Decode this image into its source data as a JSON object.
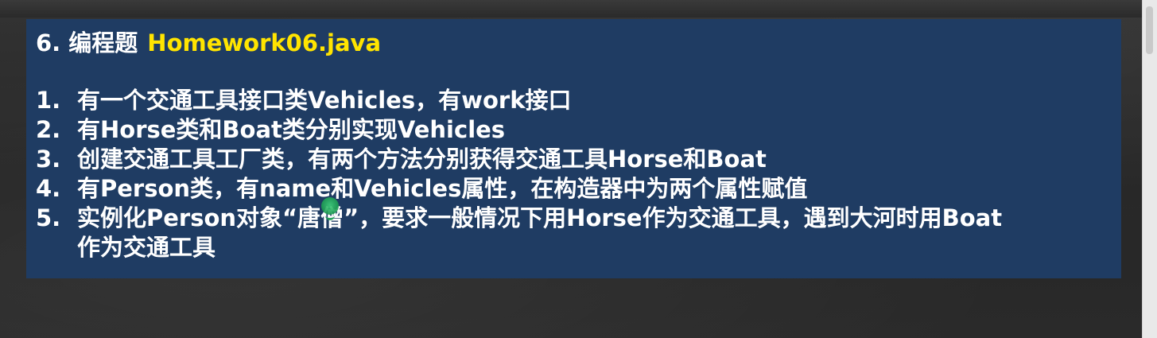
{
  "slide": {
    "title_prefix": "6. 编程题",
    "title_file": "Homework06.java",
    "items": [
      {
        "num": "1.",
        "text": "有一个交通工具接口类Vehicles，有work接口",
        "text2": ""
      },
      {
        "num": "2.",
        "text": "有Horse类和Boat类分别实现Vehicles",
        "text2": ""
      },
      {
        "num": "3.",
        "text": "创建交通工具工厂类，有两个方法分别获得交通工具Horse和Boat",
        "text2": ""
      },
      {
        "num": "4.",
        "text": "有Person类，有name和Vehicles属性，在构造器中为两个属性赋值",
        "text2": ""
      },
      {
        "num": "5.",
        "text": "实例化Person对象“唐僧”，要求一般情况下用Horse作为交通工具，遇到大河时用Boat",
        "text2": "作为交通工具"
      }
    ]
  },
  "colors": {
    "slide_background": "#1f3c63",
    "title_highlight": "#ffe400",
    "text": "#ffffff"
  }
}
